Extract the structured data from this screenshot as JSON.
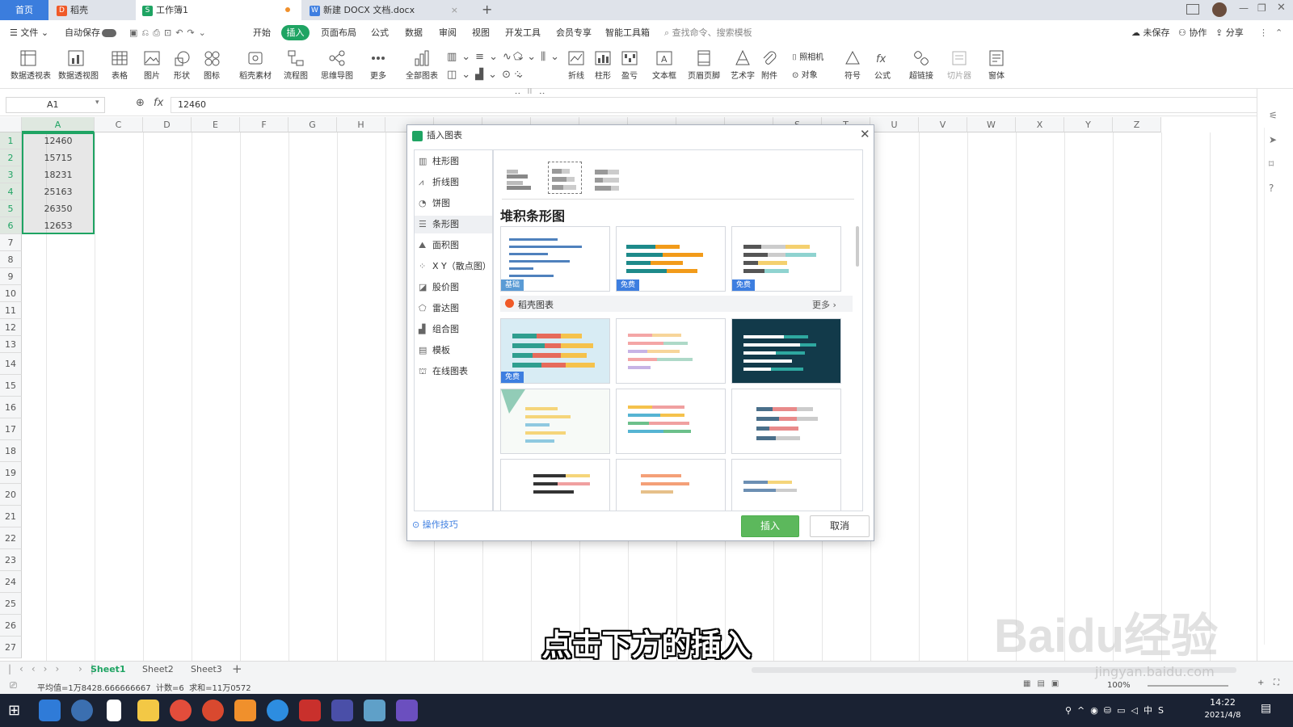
{
  "tabs": [
    {
      "label": "首页"
    },
    {
      "label": "稻壳",
      "icon_color": "#f05a28"
    },
    {
      "label": "工作簿1",
      "icon_color": "#1fa463"
    },
    {
      "label": "新建 DOCX 文档.docx",
      "icon_color": "#3d7ee0"
    }
  ],
  "menu": {
    "file": "文件",
    "autosave": "自动保存",
    "items": [
      "开始",
      "插入",
      "页面布局",
      "公式",
      "数据",
      "审阅",
      "视图",
      "开发工具",
      "会员专享",
      "智能工具箱"
    ],
    "active": "插入",
    "search_placeholder": "查找命令、搜索模板",
    "unsaved": "未保存",
    "collab": "协作",
    "share": "分享"
  },
  "ribbon": [
    {
      "label": "数据透视表",
      "icon": "pivot-table-icon"
    },
    {
      "label": "数据透视图",
      "icon": "pivot-chart-icon"
    },
    {
      "label": "表格",
      "icon": "table-icon"
    },
    {
      "label": "图片",
      "icon": "picture-icon"
    },
    {
      "label": "形状",
      "icon": "shape-icon"
    },
    {
      "label": "图标",
      "icon": "icons-icon"
    },
    {
      "label": "稻壳素材",
      "icon": "material-icon"
    },
    {
      "label": "流程图",
      "icon": "flowchart-icon"
    },
    {
      "label": "思维导图",
      "icon": "mindmap-icon"
    },
    {
      "label": "更多",
      "icon": "more-icon"
    },
    {
      "label": "全部图表",
      "icon": "all-charts-icon"
    },
    {
      "label": "折线",
      "icon": "sparkline-line-icon"
    },
    {
      "label": "柱形",
      "icon": "sparkline-column-icon"
    },
    {
      "label": "盈亏",
      "icon": "sparkline-winloss-icon"
    },
    {
      "label": "文本框",
      "icon": "textbox-icon"
    },
    {
      "label": "页眉页脚",
      "icon": "header-footer-icon"
    },
    {
      "label": "艺术字",
      "icon": "wordart-icon"
    },
    {
      "label": "附件",
      "icon": "attachment-icon"
    },
    {
      "label": "符号",
      "icon": "symbol-icon"
    },
    {
      "label": "公式",
      "icon": "formula-icon"
    },
    {
      "label": "超链接",
      "icon": "hyperlink-icon"
    },
    {
      "label": "切片器",
      "icon": "slicer-icon"
    },
    {
      "label": "窗体",
      "icon": "form-icon"
    }
  ],
  "ribbon_small": {
    "camera": "照相机",
    "object": "对象"
  },
  "formula": {
    "cell_ref": "A1",
    "value": "12460"
  },
  "columns": [
    "A",
    "C",
    "D",
    "E",
    "F",
    "G",
    "H",
    "",
    "",
    "",
    "",
    "",
    "",
    "",
    "",
    "S",
    "T",
    "U",
    "V",
    "W",
    "X",
    "Y",
    "Z"
  ],
  "rows": [
    "1",
    "2",
    "3",
    "4",
    "5",
    "6",
    "7",
    "8",
    "9",
    "10",
    "11",
    "12",
    "13",
    "14",
    "15",
    "16",
    "17",
    "18",
    "19",
    "20",
    "21",
    "22",
    "23",
    "24",
    "25",
    "26",
    "27"
  ],
  "cells_a": [
    "12460",
    "15715",
    "18231",
    "25163",
    "26350",
    "12653"
  ],
  "sheets": [
    "Sheet1",
    "Sheet2",
    "Sheet3"
  ],
  "status": "平均值=1万8428.666666667  计数=6  求和=11万0572",
  "zoom": "100%",
  "clock": {
    "time": "14:22",
    "date": "2021/4/8"
  },
  "dialog": {
    "title": "插入图表",
    "categories": [
      "柱形图",
      "折线图",
      "饼图",
      "条形图",
      "面积图",
      "X Y（散点图）",
      "股价图",
      "雷达图",
      "组合图",
      "模板",
      "在线图表"
    ],
    "selected_category": "条形图",
    "section_title": "堆积条形图",
    "badges": [
      "基础",
      "免费",
      "免费",
      "免费"
    ],
    "daoke_label": "稻壳图表",
    "more": "更多",
    "tips": "操作技巧",
    "insert": "插入",
    "cancel": "取消"
  },
  "caption": "点击下方的插入",
  "watermark": {
    "brand": "Baidu经验",
    "url": "jingyan.baidu.com"
  },
  "colors": {
    "accent_green": "#1fa463",
    "tab_blue": "#3b7ddd",
    "insert_btn": "#5cb85c",
    "selection": "#1fa463"
  }
}
